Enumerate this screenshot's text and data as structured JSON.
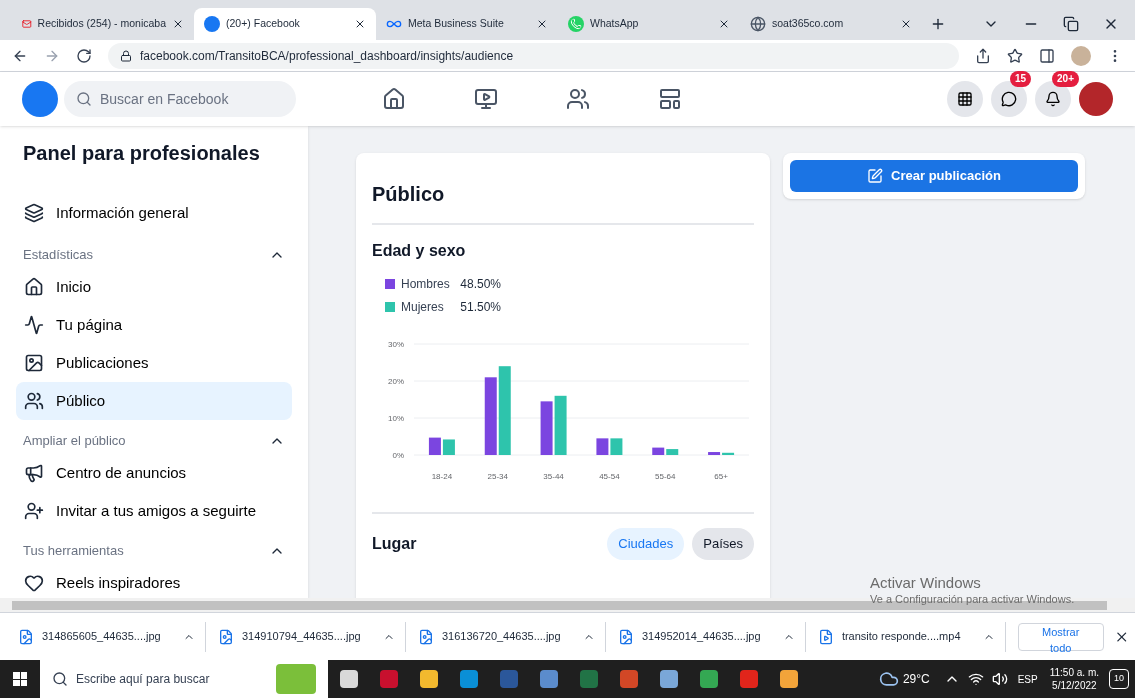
{
  "browser": {
    "tabs": [
      {
        "title": "Recibidos (254) - monicaba",
        "kind": "gmail",
        "selected": false
      },
      {
        "title": "(20+) Facebook",
        "kind": "facebook",
        "selected": true
      },
      {
        "title": "Meta Business Suite",
        "kind": "meta",
        "selected": false
      },
      {
        "title": "WhatsApp",
        "kind": "whatsapp",
        "selected": false
      },
      {
        "title": "soat365co.com",
        "kind": "web",
        "selected": false
      }
    ],
    "url": "facebook.com/TransitoBCA/professional_dashboard/insights/audience"
  },
  "facebook": {
    "search_placeholder": "Buscar en Facebook",
    "messenger_badge": "15",
    "notifications_badge": "20+"
  },
  "sidebar": {
    "title": "Panel para profesionales",
    "items": [
      {
        "kind": "link",
        "label": "Información general",
        "selected": false
      },
      {
        "kind": "section",
        "label": "Estadísticas",
        "expanded": true,
        "children": [
          {
            "kind": "link",
            "label": "Inicio",
            "selected": false
          },
          {
            "kind": "link",
            "label": "Tu página",
            "selected": false
          },
          {
            "kind": "link",
            "label": "Publicaciones",
            "selected": false
          },
          {
            "kind": "link",
            "label": "Público",
            "selected": true
          }
        ]
      },
      {
        "kind": "section",
        "label": "Ampliar el público",
        "expanded": true,
        "children": [
          {
            "kind": "link",
            "label": "Centro de anuncios",
            "selected": false
          },
          {
            "kind": "link",
            "label": "Invitar a tus amigos a seguirte",
            "selected": false
          }
        ]
      },
      {
        "kind": "section",
        "label": "Tus herramientas",
        "expanded": true,
        "children": [
          {
            "kind": "link",
            "label": "Reels inspiradores",
            "selected": false
          }
        ]
      }
    ]
  },
  "audience": {
    "title": "Público",
    "age_gender": {
      "title": "Edad y sexo",
      "legend_values": [
        "48.50%",
        "51.50%"
      ],
      "chart_data": {
        "type": "bar",
        "categories": [
          "18-24",
          "25-34",
          "35-44",
          "45-54",
          "55-64",
          "65+"
        ],
        "series": [
          {
            "name": "Hombres",
            "color": "#7b45e0",
            "values": [
              4.7,
              21,
              14.5,
              4.5,
              2,
              0.8
            ]
          },
          {
            "name": "Mujeres",
            "color": "#2ec4ac",
            "values": [
              4.2,
              24,
              16,
              4.5,
              1.6,
              0.6
            ]
          }
        ],
        "ylim": [
          0,
          30
        ],
        "yticks": [
          {
            "value": 0,
            "label": "0%"
          },
          {
            "value": 10,
            "label": "10%"
          },
          {
            "value": 20,
            "label": "20%"
          },
          {
            "value": 30,
            "label": "30%"
          }
        ]
      }
    },
    "location": {
      "title": "Lugar",
      "tabs": [
        {
          "label": "Ciudades",
          "selected": true
        },
        {
          "label": "Países",
          "selected": false
        }
      ]
    }
  },
  "create_post": "Crear publicación",
  "windows_notice": {
    "title": "Activar Windows",
    "text": "Ve a Configuración para activar Windows."
  },
  "downloads": {
    "items": [
      {
        "name": "314865605_44635....jpg",
        "kind": "image"
      },
      {
        "name": "314910794_44635....jpg",
        "kind": "image"
      },
      {
        "name": "316136720_44635....jpg",
        "kind": "image"
      },
      {
        "name": "314952014_44635....jpg",
        "kind": "image"
      },
      {
        "name": "transito responde....mp4",
        "kind": "video"
      }
    ],
    "show_all": "Mostrar todo"
  },
  "taskbar": {
    "search_placeholder": "Escribe aquí para buscar",
    "weather": "29°C",
    "language": "ESP",
    "time": "11:50 a. m.",
    "date": "5/12/2022",
    "notifications": "10"
  }
}
